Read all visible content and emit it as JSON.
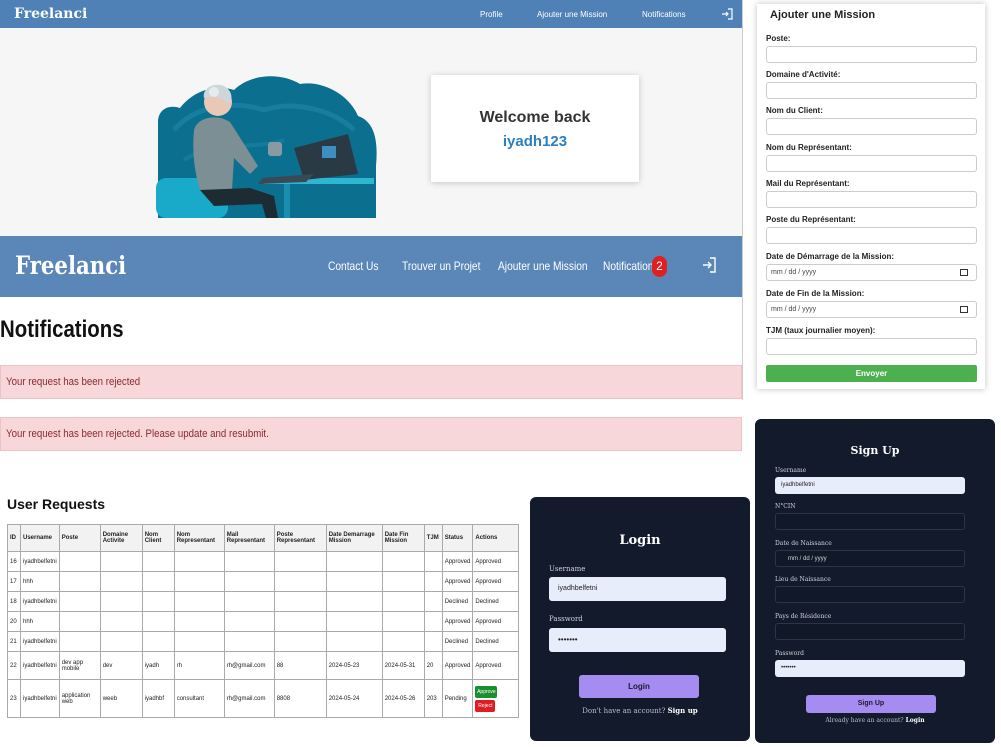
{
  "home": {
    "logo": "Freelanci",
    "nav": [
      "Profile",
      "Ajouter une Mission",
      "Notifications"
    ],
    "welcome_title": "Welcome back",
    "username": "iyadh123"
  },
  "notifications": {
    "logo": "Freelanci",
    "nav": [
      "Contact Us",
      "Trouver un Projet",
      "Ajouter une Mission",
      "Notifications"
    ],
    "badge_count": "2",
    "heading": "Notifications",
    "alerts": [
      "Your request has been rejected",
      "Your request has been rejected. Please update and resubmit."
    ]
  },
  "requests": {
    "heading": "User Requests",
    "columns": [
      "ID",
      "Username",
      "Poste",
      "Domaine Activite",
      "Nom Client",
      "Nom Representant",
      "Mail Representant",
      "Poste Representant",
      "Date Demarrage Mission",
      "Date Fin Mission",
      "TJM",
      "Status",
      "Actions"
    ],
    "rows": [
      [
        "16",
        "iyadhbelfetni",
        "",
        "",
        "",
        "",
        "",
        "",
        "",
        "",
        "",
        "Approved",
        "Approved"
      ],
      [
        "17",
        "hhh",
        "",
        "",
        "",
        "",
        "",
        "",
        "",
        "",
        "",
        "Approved",
        "Approved"
      ],
      [
        "18",
        "iyadhbelfetni",
        "",
        "",
        "",
        "",
        "",
        "",
        "",
        "",
        "",
        "Declined",
        "Declined"
      ],
      [
        "20",
        "hhh",
        "",
        "",
        "",
        "",
        "",
        "",
        "",
        "",
        "",
        "Approved",
        "Approved"
      ],
      [
        "21",
        "iyadhbelfetni",
        "",
        "",
        "",
        "",
        "",
        "",
        "",
        "",
        "",
        "Declined",
        "Declined"
      ],
      [
        "22",
        "iyadhbelfetni",
        "dev app mobile",
        "dev",
        "iyadh",
        "rh",
        "rh@gmail.com",
        "88",
        "2024-05-23",
        "2024-05-31",
        "20",
        "Approved",
        "Approved"
      ],
      [
        "23",
        "iyadhbelfetni",
        "application web",
        "weeb",
        "iyadhbf",
        "consultant",
        "rh@gmail.com",
        "8808",
        "2024-05-24",
        "2024-05-26",
        "203",
        "Pending",
        ""
      ]
    ],
    "approve_label": "Approve",
    "reject_label": "Reject",
    "colors": {
      "approve": "#1a8f2e",
      "reject": "#e01c24"
    }
  },
  "mission_form": {
    "title": "Ajouter une Mission",
    "fields": [
      {
        "label": "Poste:",
        "value": ""
      },
      {
        "label": "Domaine d'Activité:",
        "value": ""
      },
      {
        "label": "Nom du Client:",
        "value": ""
      },
      {
        "label": "Nom du Représentant:",
        "value": ""
      },
      {
        "label": "Mail du Représentant:",
        "value": ""
      },
      {
        "label": "Poste du Représentant:",
        "value": ""
      },
      {
        "label": "Date de Démarrage de la Mission:",
        "value": "mm / dd / yyyy"
      },
      {
        "label": "Date de Fin de la Mission:",
        "value": "mm / dd / yyyy"
      },
      {
        "label": "TJM (taux journalier moyen):",
        "value": ""
      }
    ],
    "submit": "Envoyer",
    "submit_color": "#4caf50"
  },
  "login": {
    "title": "Login",
    "username_label": "Username",
    "username_value": "iyadhbelfetni",
    "password_label": "Password",
    "password_value": "•••••••",
    "button": "Login",
    "footer_text": "Don't have an account?",
    "footer_link": "Sign up"
  },
  "signup": {
    "title": "Sign Up",
    "fields": [
      {
        "label": "Username",
        "value": "iyadhbelfetni"
      },
      {
        "label": "N°CIN",
        "value": ""
      },
      {
        "label": "Date de Naissance",
        "value": "mm / dd / yyyy"
      },
      {
        "label": "Lieu de Naissance",
        "value": ""
      },
      {
        "label": "Pays de Résidence",
        "value": ""
      },
      {
        "label": "Password",
        "value": "•••••••"
      }
    ],
    "button": "Sign Up",
    "footer_text": "Already have an account?",
    "footer_link": "Login",
    "button_color": "#a48cf0"
  }
}
